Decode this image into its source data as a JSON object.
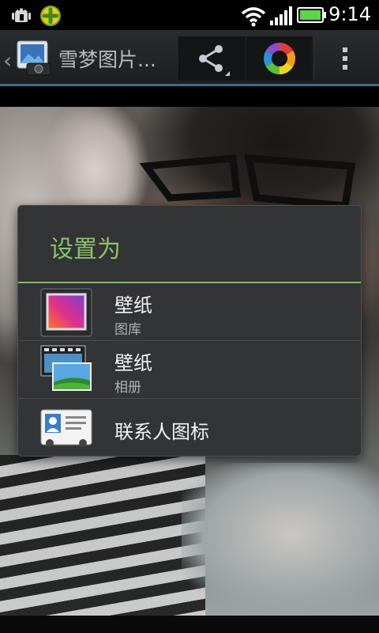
{
  "status_bar": {
    "time": "9:14",
    "icons": [
      "android-debug-icon",
      "360-security-icon",
      "wifi-icon",
      "signal-icon",
      "battery-icon"
    ],
    "accent": "#5fd14a"
  },
  "action_bar": {
    "title": "雪梦图片...",
    "back_icon": "chevron-left-icon",
    "buttons": [
      "share-icon",
      "color-wheel-icon",
      "overflow-menu-icon"
    ]
  },
  "dialog": {
    "title": "设置为",
    "title_color": "#8cc36a",
    "items": [
      {
        "label": "壁纸",
        "sub": "图库",
        "icon": "gallery-wallpaper-icon"
      },
      {
        "label": "壁纸",
        "sub": "相册",
        "icon": "album-wallpaper-icon"
      },
      {
        "label": "联系人图标",
        "sub": "",
        "icon": "contact-card-icon"
      }
    ]
  }
}
